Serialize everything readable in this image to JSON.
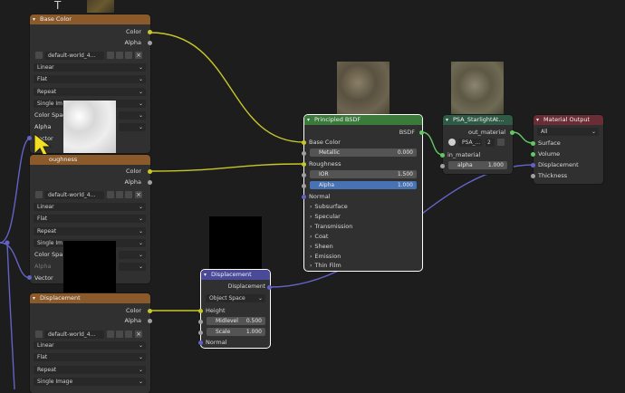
{
  "top_cut_text": "T",
  "tex1": {
    "title": "Base Color",
    "out_color": "Color",
    "out_alpha": "Alpha",
    "image_name": "default-world_4...",
    "interp": "Linear",
    "proj": "Flat",
    "ext": "Repeat",
    "source": "Single Im",
    "colorspace": "Color Spac",
    "alpha": "Alpha",
    "vector": "Vector"
  },
  "tex2": {
    "title": "oughness",
    "out_color": "Color",
    "out_alpha": "Alpha",
    "image_name": "default-world_4...",
    "interp": "Linear",
    "proj": "Flat",
    "ext": "Repeat",
    "source": "Single Im",
    "colorspace": "Color Spa",
    "alpha": "Alpha",
    "vector": "Vector"
  },
  "tex3": {
    "title": "Displacement",
    "out_color": "Color",
    "out_alpha": "Alpha",
    "image_name": "default-world_4...",
    "interp": "Linear",
    "proj": "Flat",
    "ext": "Repeat",
    "source": "Single Image"
  },
  "bsdf": {
    "title": "Principled BSDF",
    "out": "BSDF",
    "base_color": "Base Color",
    "metallic_label": "Metallic",
    "metallic_value": "0.000",
    "roughness": "Roughness",
    "ior_label": "IOR",
    "ior_value": "1.500",
    "alpha_label": "Alpha",
    "alpha_value": "1.000",
    "normal": "Normal",
    "panels": [
      "Subsurface",
      "Specular",
      "Transmission",
      "Coat",
      "Sheen",
      "Emission",
      "Thin Film"
    ]
  },
  "group": {
    "title": "PSA_StarlightAt...",
    "out": "out_material",
    "datablock": "PSA_...",
    "users": "2",
    "in_material": "in_material",
    "alpha_label": "alpha",
    "alpha_value": "1.000"
  },
  "output": {
    "title": "Material Output",
    "target": "All",
    "surface": "Surface",
    "volume": "Volume",
    "displacement": "Displacement",
    "thickness": "Thickness"
  },
  "disp": {
    "title": "Displacement",
    "out": "Displacement",
    "space": "Object Space",
    "height": "Height",
    "midlevel_label": "Midlevel",
    "midlevel_value": "0.500",
    "scale_label": "Scale",
    "scale_value": "1.000",
    "normal": "Normal"
  },
  "colors": {
    "link_color": "#c7c729",
    "link_grey": "#a1a1a1",
    "link_vector": "#6363c7",
    "link_shader": "#63c763",
    "texture_header": "#8a5a2b",
    "shader_header": "#3a7a3a",
    "output_header": "#6a2d35",
    "vector_header": "#4a4a9a",
    "cursor": "#f0e020"
  }
}
